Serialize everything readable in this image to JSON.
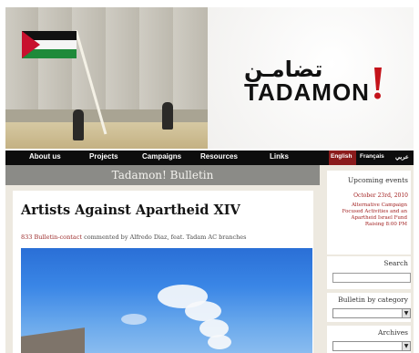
{
  "logo": {
    "arabic": "تضامـن",
    "latin": "TADAMON"
  },
  "nav": {
    "items": [
      "About us",
      "Projects",
      "Campaigns",
      "Resources",
      "Links"
    ],
    "languages": [
      "English",
      "Français",
      "عربي"
    ]
  },
  "bulletin": {
    "title": "Tadamon! Bulletin"
  },
  "article": {
    "title": "Artists Against Apartheid XIV",
    "meta_link": "833 Bulletin-contact",
    "meta_rest": "commented by Alfredo Diaz, feat. Tadam AC branches"
  },
  "sidebar": {
    "upcoming": {
      "heading": "Upcoming events",
      "date": "October 23rd, 2010",
      "text": "Alternative Campaign Focused Activities and an Apartheid Israel Fund Raising 8:00 PM"
    },
    "search": {
      "heading": "Search",
      "value": ""
    },
    "bulletin_by_category": {
      "heading": "Bulletin by category",
      "selected": ""
    },
    "archives": {
      "heading": "Archives",
      "selected": ""
    }
  },
  "colors": {
    "nav_bg": "#0d0d0d",
    "accent_red": "#a11f1f",
    "bulletin_bar": "#8b8b87"
  }
}
